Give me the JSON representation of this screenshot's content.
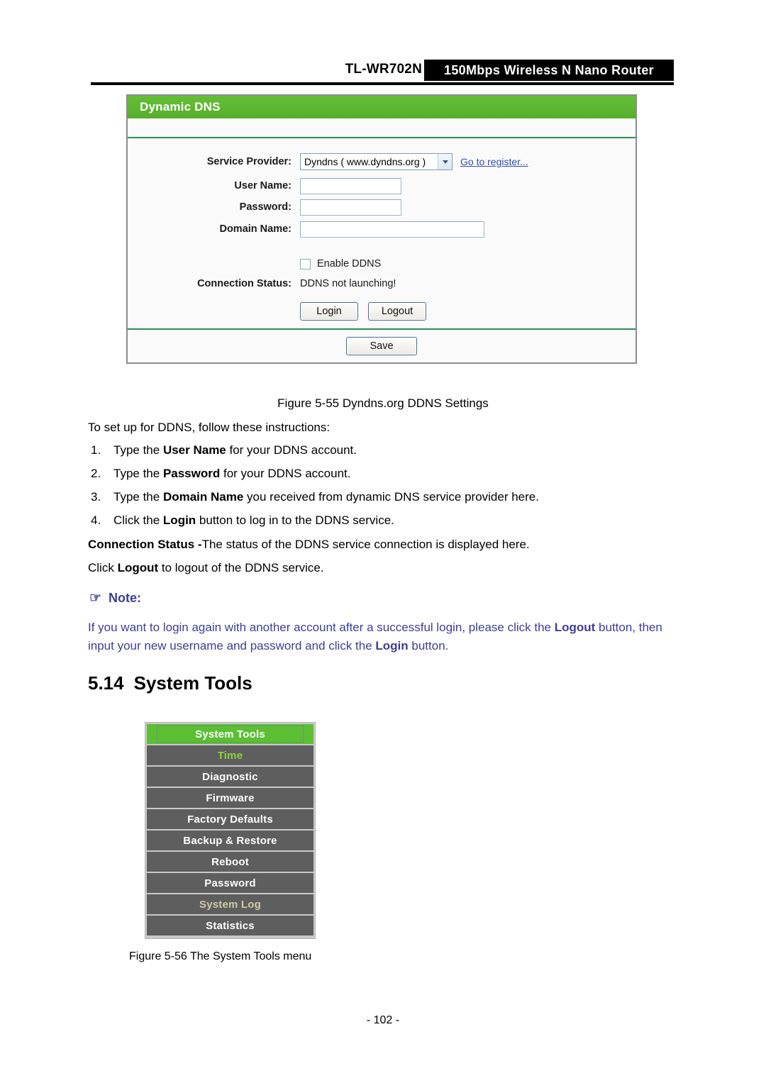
{
  "header": {
    "model": "TL-WR702N",
    "banner": "150Mbps  Wireless  N  Nano  Router"
  },
  "ddns_panel": {
    "title": "Dynamic DNS",
    "service_provider_label": "Service Provider:",
    "service_provider_value": "Dyndns ( www.dyndns.org )",
    "register_link": "Go to register...",
    "user_name_label": "User Name:",
    "user_name_value": "",
    "password_label": "Password:",
    "password_value": "",
    "domain_name_label": "Domain Name:",
    "domain_name_value": "",
    "enable_ddns_label": "Enable DDNS",
    "enable_ddns_checked": "false",
    "connection_status_label": "Connection Status:",
    "connection_status_value": "DDNS not launching!",
    "login_button": "Login",
    "logout_button": "Logout",
    "save_button": "Save",
    "accent_green": "#5cb531",
    "border_gray": "#8c8c8c"
  },
  "figure_55_caption": "Figure 5-55    Dyndns.org DDNS Settings",
  "intro_text": "To set up for DDNS, follow these instructions:",
  "instructions": [
    {
      "num": "1.",
      "pre": "Type the ",
      "bold": "User Name",
      "post": " for your DDNS account."
    },
    {
      "num": "2.",
      "pre": "Type the ",
      "bold": "Password",
      "post": " for your DDNS account."
    },
    {
      "num": "3.",
      "pre": "Type the ",
      "bold": "Domain Name",
      "post": " you received from dynamic DNS service provider here."
    },
    {
      "num": "4.",
      "pre": "Click the ",
      "bold": "Login",
      "post": " button to log in to the DDNS service."
    }
  ],
  "connection_status_paragraph": {
    "bold": "Connection Status -",
    "rest": "The status of the DDNS service connection is displayed here."
  },
  "logout_paragraph": {
    "pre": "Click ",
    "bold": "Logout",
    "post": " to logout of the DDNS service."
  },
  "note": {
    "icon": "hand-pointing-right-icon",
    "glyph": "☞",
    "heading": "Note:",
    "line1_pre": "If you want to login again with another account after a successful login, please click the ",
    "line1_bold": "Logout",
    "line2_pre": "button, then input your new username and password and click the ",
    "line2_bold": "Login",
    "line2_post": " button.",
    "color": "#3b3f92"
  },
  "section": {
    "number": "5.14",
    "title": "System Tools"
  },
  "system_tools_menu": {
    "items": [
      {
        "label": "System Tools",
        "state": "header"
      },
      {
        "label": "Time",
        "state": "active"
      },
      {
        "label": "Diagnostic",
        "state": "normal"
      },
      {
        "label": "Firmware",
        "state": "normal"
      },
      {
        "label": "Factory Defaults",
        "state": "normal"
      },
      {
        "label": "Backup & Restore",
        "state": "normal"
      },
      {
        "label": "Reboot",
        "state": "normal"
      },
      {
        "label": "Password",
        "state": "normal"
      },
      {
        "label": "System Log",
        "state": "visited"
      },
      {
        "label": "Statistics",
        "state": "normal"
      }
    ],
    "header_green": "#5cbf33",
    "item_gray": "#5e5e5e",
    "active_green": "#8dd63a"
  },
  "figure_56_caption": "Figure 5-56 The System Tools menu",
  "page_number": "- 102 -"
}
